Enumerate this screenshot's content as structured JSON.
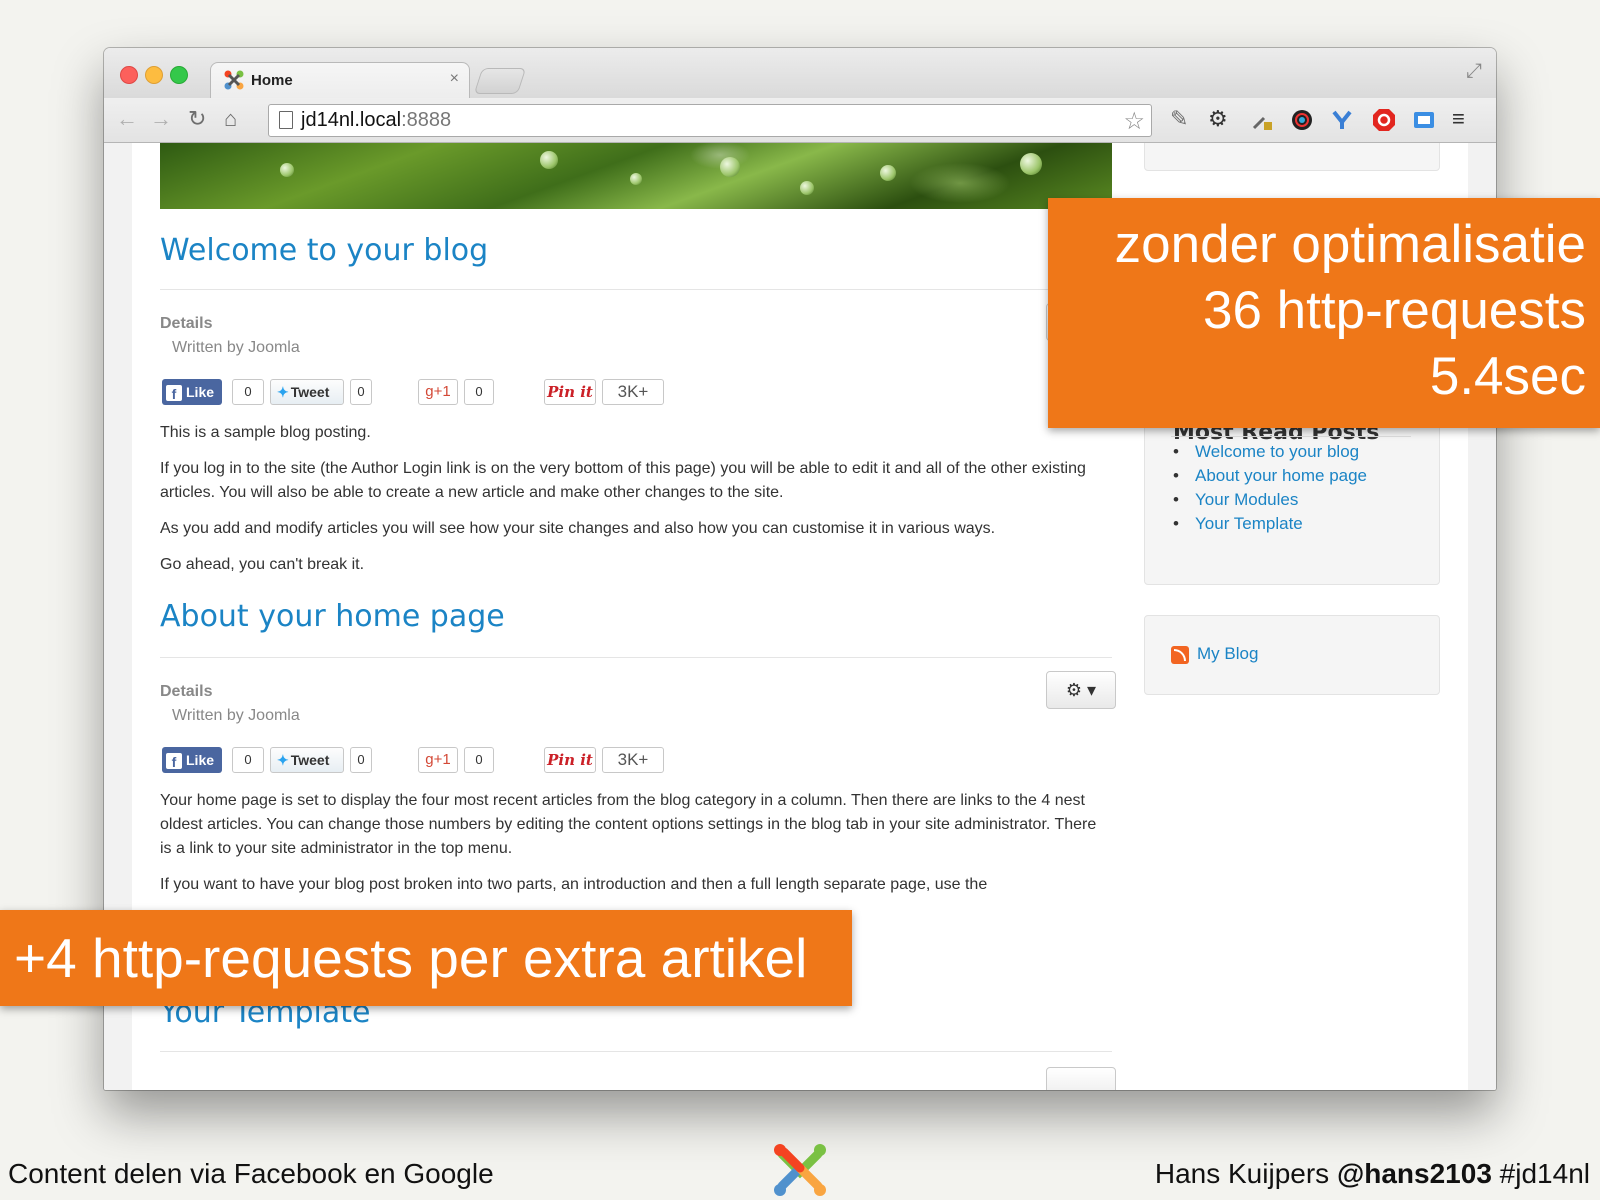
{
  "browser": {
    "tab_title": "Home",
    "tab_close": "×",
    "url_host": "jd14nl.local",
    "url_port": ":8888"
  },
  "articles": [
    {
      "title": "Welcome to your blog",
      "details_label": "Details",
      "author": "Written by Joomla",
      "social": {
        "like_label": "Like",
        "like_count": "0",
        "tweet_label": "Tweet",
        "tweet_count": "0",
        "gplus_label": "+1",
        "gplus_count": "0",
        "pin_label": "Pin it",
        "pin_count": "3K+"
      },
      "paragraphs": [
        "This is a sample blog posting.",
        "If you log in to the site (the Author Login link is on the very bottom of this page) you will be able to edit it and all of the other existing articles. You will also be able to create a new article and make other changes to the site.",
        "As you add and modify articles you will see how your site changes and also how you can customise it in various ways.",
        "Go ahead, you can't break it."
      ]
    },
    {
      "title": "About your home page",
      "details_label": "Details",
      "author": "Written by Joomla",
      "social": {
        "like_label": "Like",
        "like_count": "0",
        "tweet_label": "Tweet",
        "tweet_count": "0",
        "gplus_label": "+1",
        "gplus_count": "0",
        "pin_label": "Pin it",
        "pin_count": "3K+"
      },
      "paragraphs": [
        "Your home page is set to display the four most recent articles from the blog category in a column. Then there are links to the 4 nest oldest articles. You can change those numbers by editing the content options settings in the blog tab in your site administrator. There is a link to your site administrator in the top menu.",
        "If you want to have your blog post broken into two parts, an introduction and then a full length separate page, use the"
      ]
    },
    {
      "title": "Your Template"
    }
  ],
  "sidebar": {
    "most_read_heading": "Most Read Posts",
    "most_read": [
      "Welcome to your blog",
      "About your home page",
      "Your Modules",
      "Your Template"
    ],
    "feed_link": "My Blog"
  },
  "slide": {
    "callout_right": [
      "zonder optimalisatie",
      "36 http-requests",
      "5.4sec"
    ],
    "callout_left": "+4 http-requests per extra artikel",
    "footer_left": "Content delen via Facebook en Google",
    "footer_author": "Hans Kuijpers ",
    "footer_handle": "@hans2103",
    "footer_tag": " #jd14nl"
  },
  "colors": {
    "accent_orange": "#ef7718",
    "link_blue": "#1b84c5",
    "facebook_blue": "#4a66a0"
  },
  "icons": [
    "back-icon",
    "forward-icon",
    "reload-icon",
    "home-icon",
    "star-icon",
    "wrench-icon",
    "gear-icon",
    "menu-icon",
    "rss-icon",
    "joomla-logo"
  ]
}
